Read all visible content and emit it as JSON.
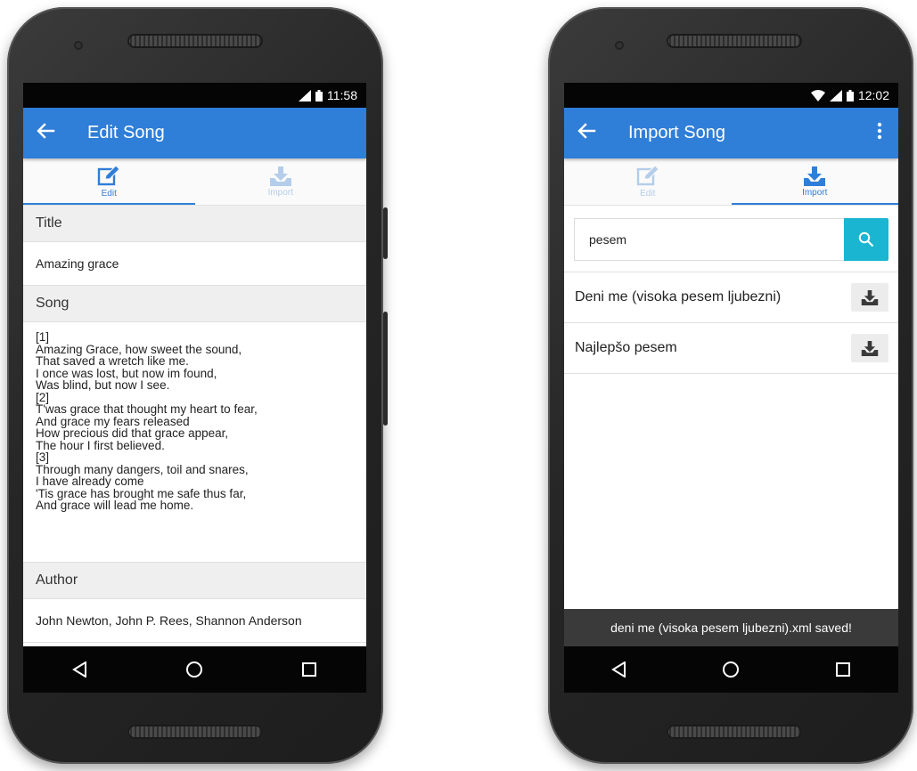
{
  "edit_screen": {
    "status_time": "11:58",
    "title": "Edit Song",
    "tabs": [
      {
        "label": "Edit",
        "active": true,
        "icon": "edit-icon"
      },
      {
        "label": "Import",
        "active": false,
        "icon": "download-icon"
      }
    ],
    "title_header": "Title",
    "title_value": "Amazing grace",
    "song_header": "Song",
    "song_value": "[1]\nAmazing Grace, how sweet the sound,\nThat saved a wretch like me.\nI once was lost, but now im found,\nWas blind, but now I see.\n[2]\nT'was grace that thought my heart to fear,\nAnd grace my fears released\nHow precious did that grace appear,\nThe  hour I first believed.\n[3]\nThrough many dangers, toil and snares,\nI have already come\n'Tis grace has brought me safe thus far,\nAnd grace will lead me home.",
    "author_header": "Author",
    "author_value": "John Newton, John P. Rees, Shannon Anderson"
  },
  "import_screen": {
    "status_time": "12:02",
    "title": "Import Song",
    "tabs": [
      {
        "label": "Edit",
        "active": false,
        "icon": "edit-icon"
      },
      {
        "label": "Import",
        "active": true,
        "icon": "download-icon"
      }
    ],
    "search_value": "pesem",
    "results": [
      {
        "title": "Deni me (visoka pesem ljubezni)"
      },
      {
        "title": "Najlepšo pesem"
      }
    ],
    "toast": "deni me (visoka pesem ljubezni).xml saved!"
  },
  "colors": {
    "appbar": "#2f7ed8",
    "search_button": "#1ab6d1",
    "inactive_tab": "#b4cdea"
  }
}
